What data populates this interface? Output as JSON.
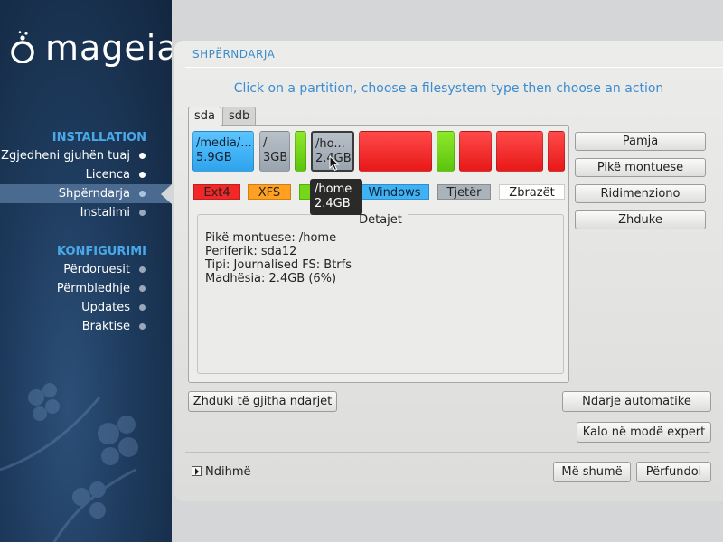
{
  "brand": {
    "logo_text": "mageia"
  },
  "sidebar": {
    "installation_title": "INSTALLATION",
    "installation_items": [
      {
        "label": "Zgjedheni gjuhën tuaj"
      },
      {
        "label": "Licenca"
      },
      {
        "label": "Shpërndarja"
      },
      {
        "label": "Instalimi"
      }
    ],
    "configuration_title": "KONFIGURIMI",
    "configuration_items": [
      {
        "label": "Përdoruesit"
      },
      {
        "label": "Përmbledhje"
      },
      {
        "label": "Updates"
      },
      {
        "label": "Braktise"
      }
    ],
    "active_item": "Shpërndarja"
  },
  "main": {
    "step_title": "SHPËRNDARJA",
    "instruction": "Click on a partition, choose a filesystem type then choose an action",
    "tabs": [
      {
        "label": "sda"
      },
      {
        "label": "sdb"
      }
    ],
    "partitions": [
      {
        "label": "/media/...",
        "size": "5.9GB",
        "color": "#3fb2f5"
      },
      {
        "label": "/",
        "size": "3GB",
        "color": "#aab2ba"
      },
      {
        "label": "",
        "size": "",
        "color": "#74d81a"
      },
      {
        "label": "/ho...",
        "size": "2.4GB",
        "color": "#aab2ba"
      },
      {
        "label": "",
        "size": "",
        "color": "#f22828"
      },
      {
        "label": "",
        "size": "",
        "color": "#74d81a"
      },
      {
        "label": "",
        "size": "",
        "color": "#f22828"
      },
      {
        "label": "",
        "size": "",
        "color": "#f22828"
      },
      {
        "label": "",
        "size": "",
        "color": "#f22828"
      }
    ],
    "tooltip": {
      "line1": "/home",
      "line2": "2.4GB"
    },
    "legend": [
      {
        "label": "Ext4",
        "color": "#f22828"
      },
      {
        "label": "XFS",
        "color": "#ffa020"
      },
      {
        "label": "",
        "color": "#74d81a"
      },
      {
        "label": "Windows",
        "color": "#3fb2f5"
      },
      {
        "label": "Tjetër",
        "color": "#aab2ba"
      },
      {
        "label": "Zbrazët",
        "color": "#ffffff"
      }
    ],
    "details": {
      "title": "Detajet",
      "mount_point": "Pikë montuese: /home",
      "device": "Periferik: sda12",
      "type": "Tipi: Journalised FS: Btrfs",
      "size": "Madhësia: 2.4GB (6%)"
    },
    "actions": {
      "view": "Pamja",
      "mount_point": "Pikë montuese",
      "resize": "Ridimenziono",
      "delete": "Zhduke"
    },
    "delete_all": "Zhduki të gjitha ndarjet",
    "auto_allocate": "Ndarje automatike",
    "expert_mode": "Kalo në modë expert",
    "help": "Ndihmë",
    "more": "Më shumë",
    "done": "Përfundoi"
  }
}
